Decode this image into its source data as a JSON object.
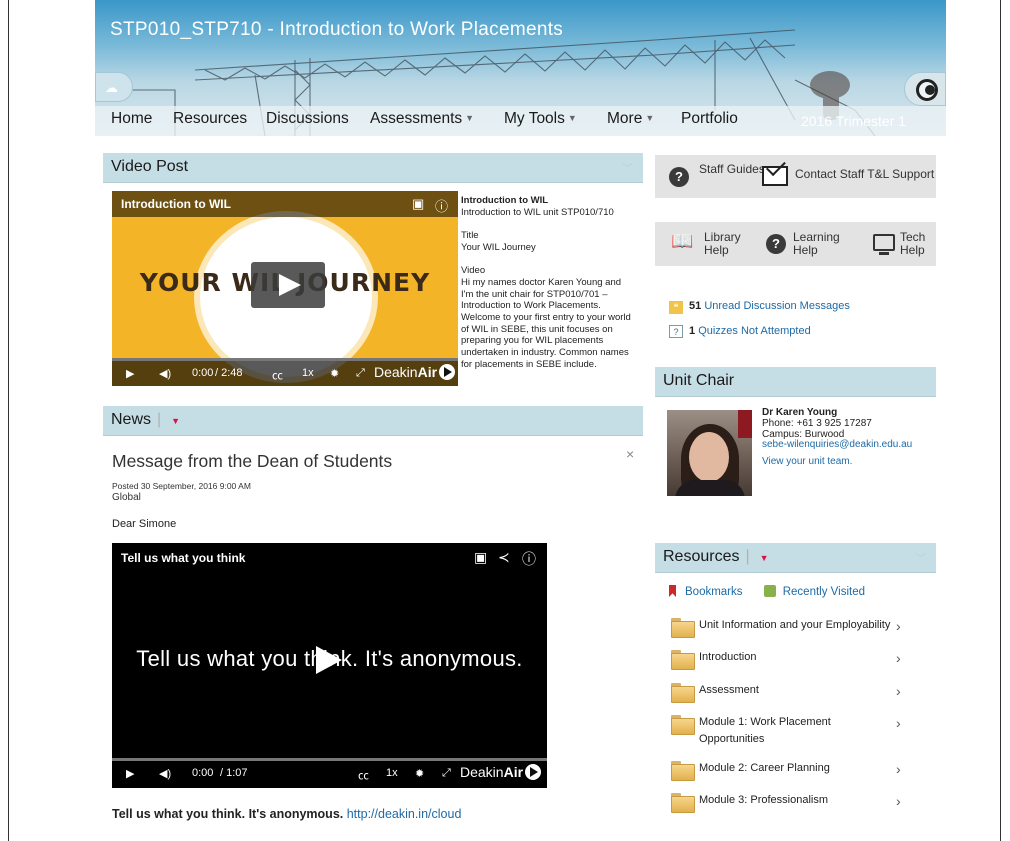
{
  "course": {
    "title": "STP010_STP710 - Introduction to Work Placements",
    "term": "2016 Trimester 1"
  },
  "nav": {
    "items": [
      {
        "label": "Home",
        "dropdown": false
      },
      {
        "label": "Resources",
        "dropdown": false
      },
      {
        "label": "Discussions",
        "dropdown": false
      },
      {
        "label": "Assessments",
        "dropdown": true
      },
      {
        "label": "My Tools",
        "dropdown": true
      },
      {
        "label": "More",
        "dropdown": true
      },
      {
        "label": "Portfolio",
        "dropdown": false
      }
    ],
    "caret": "▼"
  },
  "video_post": {
    "heading": "Video Post",
    "video": {
      "title": "Introduction to WIL",
      "poster_text": "YOUR WIL JOURNEY",
      "time_current": "0:00",
      "time_total": "/ 2:48",
      "speed": "1x",
      "brand_a": "Deakin",
      "brand_b": "Air"
    },
    "description": {
      "heading": "Introduction to WIL",
      "subheading": "Introduction to WIL unit STP010/710",
      "title_label": "Title",
      "title_value": "Your WIL Journey",
      "video_label": "Video",
      "body": "Hi my names doctor Karen Young and I'm the unit chair for STP010/701 – Introduction to Work Placements. Welcome to your first entry to your world of WIL in SEBE, this unit focuses on preparing you for WIL placements undertaken in industry. Common names for placements in SEBE include."
    }
  },
  "news": {
    "heading": "News",
    "message_title": "Message from the Dean of Students",
    "posted": "Posted 30 September, 2016 9:00 AM",
    "scope": "Global",
    "greeting": "Dear Simone",
    "video": {
      "title": "Tell us what you think",
      "overlay_text": "Tell us what you think. It's anonymous.",
      "time_current": "0:00",
      "time_total": "/ 1:07",
      "speed": "1x",
      "brand_a": "Deakin",
      "brand_b": "Air"
    },
    "footer_bold": "Tell us what you think. It's anonymous.",
    "footer_link": "http://deakin.in/cloud"
  },
  "support": {
    "staff_guides": "Staff Guides",
    "contact": "Contact Staff T&L Support",
    "library": "Library Help",
    "learning": "Learning Help",
    "tech": "Tech Help"
  },
  "stats": {
    "unread_count": "51",
    "unread_label": "Unread Discussion Messages",
    "quizzes_count": "1",
    "quizzes_label": "Quizzes Not Attempted"
  },
  "unit_chair": {
    "heading": "Unit Chair",
    "name": "Dr Karen Young",
    "phone": "Phone: +61 3 925 17287",
    "campus": "Campus: Burwood",
    "email": "sebe-wilenquiries@deakin.edu.au",
    "team_link": "View your unit team."
  },
  "resources": {
    "heading": "Resources",
    "bookmarks": "Bookmarks",
    "recent": "Recently Visited",
    "items": [
      {
        "label": "Unit Information and your Employability"
      },
      {
        "label": "Introduction"
      },
      {
        "label": "Assessment"
      },
      {
        "label": "Module 1: Work Placement Opportunities"
      },
      {
        "label": "Module 2: Career Planning"
      },
      {
        "label": "Module 3: Professionalism"
      }
    ]
  },
  "colors": {
    "accent": "#1e6aa6",
    "panel_header": "#c5dde4",
    "video_bg": "#f4b428"
  }
}
